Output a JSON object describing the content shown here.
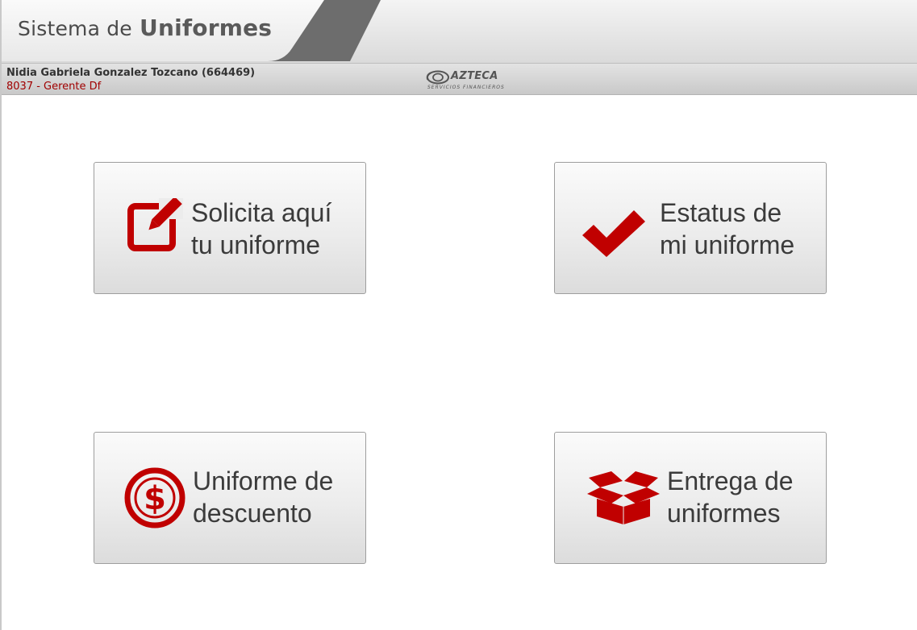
{
  "header": {
    "title_part1": "Sistema de",
    "title_part2": "Uniformes"
  },
  "user": {
    "name": "Nidia Gabriela Gonzalez Tozcano (664469)",
    "role": "8037 - Gerente Df"
  },
  "brand": {
    "name": "AZTECA",
    "subtitle": "SERVICIOS FINANCIEROS"
  },
  "tiles": [
    {
      "line1": "Solicita aquí",
      "line2": "tu uniforme",
      "icon": "edit-icon"
    },
    {
      "line1": "Estatus de",
      "line2": "mi uniforme",
      "icon": "checkmark-icon"
    },
    {
      "line1": "Uniforme de",
      "line2": "descuento",
      "icon": "dollar-icon"
    },
    {
      "line1": "Entrega de",
      "line2": "uniformes",
      "icon": "open-box-icon"
    }
  ],
  "colors": {
    "accent": "#c00000",
    "text": "#3b3b3b",
    "header_band": "#6d6d6d"
  }
}
